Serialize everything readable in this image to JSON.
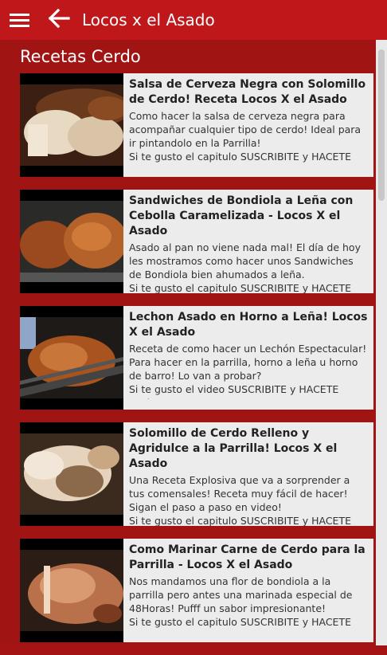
{
  "header": {
    "title": "Locos x el Asado"
  },
  "section": {
    "title": "Recetas Cerdo"
  },
  "recipes": [
    {
      "title": "Salsa de Cerveza Negra con Solomillo de Cerdo! Receta Locos X el Asado",
      "description": "Como hacer la salsa de cerveza negra para acompañar cualquier tipo de cerdo! Ideal para ir pintandolo en la Parrilla!\nSi te gusto el capitulo SUSCRIBITE y HACETE"
    },
    {
      "title": "Sandwiches de Bondiola a Leña con Cebolla Caramelizada - Locos X el Asado",
      "description": "Asado al pan no viene nada mal! El día de hoy les mostramos como hacer unos Sandwiches de Bondiola bien ahumados a leña.\nSi te gusto el capitulo SUSCRIBITE y HACETE"
    },
    {
      "title": "Lechon Asado en Horno a Leña! Locos X el Asado",
      "description": "Receta de como hacer un Lechón Espectacular! Para hacer en la parrilla, horno a leña u horno de barro! Lo van a probar?\nSi te gusto el video SUSCRIBITE y HACETE Socio"
    },
    {
      "title": "Solomillo de Cerdo Relleno y Agridulce a la Parrilla! Locos X el Asado",
      "description": "Una Receta Explosiva que va a sorprender a tus comensales! Receta muy fácil de hacer! Sigan el paso a paso en video!\nSi te gusto el capitulo SUSCRIBITE y HACETE"
    },
    {
      "title": "Como Marinar Carne de Cerdo para la Parrilla - Locos X el Asado",
      "description": "Nos mandamos una flor de bondiola a la parrilla pero antes una marinada especial de 48Horas! Pufff un sabor impresionante!\nSi te gusto el capitulo SUSCRIBITE y HACETE"
    }
  ],
  "colors": {
    "appbar": "#c0171b",
    "background": "#a51414",
    "card": "#ececec"
  },
  "icons": {
    "menu": "hamburger-icon",
    "back": "back-arrow-icon"
  }
}
